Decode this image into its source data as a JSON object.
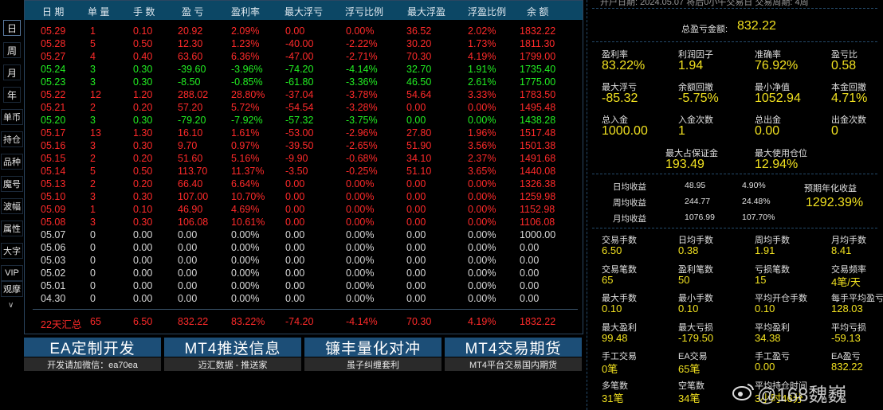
{
  "sidebar": {
    "items": [
      {
        "label": "日"
      },
      {
        "label": "周"
      },
      {
        "label": "月"
      },
      {
        "label": "年"
      },
      {
        "label": "单币"
      },
      {
        "label": "持仓"
      },
      {
        "label": "品种"
      },
      {
        "label": "魔号"
      },
      {
        "label": "波幅"
      },
      {
        "label": "属性"
      },
      {
        "label": "大字"
      },
      {
        "label": "VIP"
      },
      {
        "label": "观摩"
      }
    ]
  },
  "table": {
    "headers": [
      "日 期",
      "单 量",
      "手 数",
      "盈 亏",
      "盈利率",
      "最大浮亏",
      "浮亏比例",
      "最大浮盈",
      "浮盈比例",
      "余 额"
    ],
    "rows": [
      {
        "color": "red",
        "cells": [
          "05.29",
          "1",
          "0.10",
          "20.92",
          "2.09%",
          "0.00",
          "0.00%",
          "36.52",
          "2.02%",
          "1832.22"
        ]
      },
      {
        "color": "red",
        "cells": [
          "05.28",
          "5",
          "0.50",
          "12.30",
          "1.23%",
          "-40.00",
          "-2.22%",
          "30.20",
          "1.73%",
          "1811.30"
        ]
      },
      {
        "color": "red",
        "cells": [
          "05.27",
          "4",
          "0.40",
          "63.60",
          "6.36%",
          "-47.00",
          "-2.71%",
          "70.30",
          "4.19%",
          "1799.00"
        ]
      },
      {
        "color": "green",
        "cells": [
          "05.24",
          "3",
          "0.30",
          "-39.60",
          "-3.96%",
          "-74.20",
          "-4.14%",
          "32.70",
          "1.91%",
          "1735.40"
        ]
      },
      {
        "color": "green",
        "cells": [
          "05.23",
          "3",
          "0.30",
          "-8.50",
          "-0.85%",
          "-61.80",
          "-3.36%",
          "46.50",
          "2.61%",
          "1775.00"
        ]
      },
      {
        "color": "red",
        "cells": [
          "05.22",
          "12",
          "1.20",
          "288.02",
          "28.80%",
          "-37.04",
          "-3.78%",
          "54.64",
          "3.33%",
          "1783.50"
        ]
      },
      {
        "color": "red",
        "cells": [
          "05.21",
          "2",
          "0.20",
          "57.20",
          "5.72%",
          "-54.54",
          "-3.28%",
          "0.00",
          "0.00%",
          "1495.48"
        ]
      },
      {
        "color": "green",
        "cells": [
          "05.20",
          "3",
          "0.30",
          "-79.20",
          "-7.92%",
          "-57.32",
          "-3.75%",
          "0.00",
          "0.00%",
          "1438.28"
        ]
      },
      {
        "color": "red",
        "cells": [
          "05.17",
          "13",
          "1.30",
          "16.10",
          "1.61%",
          "-53.00",
          "-2.96%",
          "27.80",
          "1.96%",
          "1517.48"
        ]
      },
      {
        "color": "red",
        "cells": [
          "05.16",
          "3",
          "0.30",
          "9.70",
          "0.97%",
          "-39.50",
          "-2.65%",
          "51.90",
          "3.56%",
          "1501.38"
        ]
      },
      {
        "color": "red",
        "cells": [
          "05.15",
          "2",
          "0.20",
          "51.60",
          "5.16%",
          "-9.90",
          "-0.68%",
          "34.10",
          "2.37%",
          "1491.68"
        ]
      },
      {
        "color": "red",
        "cells": [
          "05.14",
          "5",
          "0.50",
          "113.70",
          "11.37%",
          "-3.50",
          "-0.25%",
          "51.10",
          "3.65%",
          "1440.08"
        ]
      },
      {
        "color": "red",
        "cells": [
          "05.13",
          "2",
          "0.20",
          "66.40",
          "6.64%",
          "0.00",
          "0.00%",
          "0.00",
          "0.00%",
          "1326.38"
        ]
      },
      {
        "color": "red",
        "cells": [
          "05.10",
          "3",
          "0.30",
          "107.00",
          "10.70%",
          "0.00",
          "0.00%",
          "0.00",
          "0.00%",
          "1259.98"
        ]
      },
      {
        "color": "red",
        "cells": [
          "05.09",
          "1",
          "0.10",
          "46.90",
          "4.69%",
          "0.00",
          "0.00%",
          "0.00",
          "0.00%",
          "1152.98"
        ]
      },
      {
        "color": "red",
        "cells": [
          "05.08",
          "3",
          "0.30",
          "106.08",
          "10.61%",
          "0.00",
          "0.00%",
          "0.00",
          "0.00%",
          "1106.08"
        ]
      },
      {
        "color": "white",
        "cells": [
          "05.07",
          "0",
          "0.00",
          "0.00",
          "0.00%",
          "0.00",
          "0.00%",
          "0.00",
          "0.00%",
          "1000.00"
        ]
      },
      {
        "color": "white",
        "cells": [
          "05.06",
          "0",
          "0.00",
          "0.00",
          "0.00%",
          "0.00",
          "0.00%",
          "0.00",
          "0.00%",
          "0.00"
        ]
      },
      {
        "color": "white",
        "cells": [
          "05.03",
          "0",
          "0.00",
          "0.00",
          "0.00%",
          "0.00",
          "0.00%",
          "0.00",
          "0.00%",
          "0.00"
        ]
      },
      {
        "color": "white",
        "cells": [
          "05.02",
          "0",
          "0.00",
          "0.00",
          "0.00%",
          "0.00",
          "0.00%",
          "0.00",
          "0.00%",
          "0.00"
        ]
      },
      {
        "color": "white",
        "cells": [
          "05.01",
          "0",
          "0.00",
          "0.00",
          "0.00%",
          "0.00",
          "0.00%",
          "0.00",
          "0.00%",
          "0.00"
        ]
      },
      {
        "color": "white",
        "cells": [
          "04.30",
          "0",
          "0.00",
          "0.00",
          "0.00%",
          "0.00",
          "0.00%",
          "0.00",
          "0.00%",
          "0.00"
        ]
      }
    ],
    "summary": [
      "22天汇总",
      "65",
      "6.50",
      "832.22",
      "83.22%",
      "-74.20",
      "-4.14%",
      "70.30",
      "4.19%",
      "1832.22"
    ]
  },
  "buttons": [
    {
      "title": "EA定制开发",
      "sub": "开发请加微信：ea70ea"
    },
    {
      "title": "MT4推送信息",
      "sub": "迈汇数据 - 推送家"
    },
    {
      "title": "镰丰量化对冲",
      "sub": "虽子纠缠套利"
    },
    {
      "title": "MT4交易期货",
      "sub": "MT4平台交易国内期货"
    }
  ],
  "panel": {
    "top_strip": "开户日期: 2024.05.07          将后0小午交易日          交易周期: 4周",
    "total_label": "总盈亏金额:",
    "total_value": "832.22",
    "grid1": [
      {
        "label": "盈利率",
        "value": "83.22%"
      },
      {
        "label": "利润因子",
        "value": "1.94"
      },
      {
        "label": "准确率",
        "value": "76.92%"
      },
      {
        "label": "盈亏比",
        "value": "0.58"
      },
      {
        "label": "最大浮亏",
        "value": "-85.32"
      },
      {
        "label": "余额回撤",
        "value": "-5.75%"
      },
      {
        "label": "最小净值",
        "value": "1052.94"
      },
      {
        "label": "本金回撤",
        "value": "4.71%"
      },
      {
        "label": "总入金",
        "value": "1000.00"
      },
      {
        "label": "入金次数",
        "value": "1"
      },
      {
        "label": "总出金",
        "value": "0.00"
      },
      {
        "label": "出金次数",
        "value": "0"
      }
    ],
    "margin": [
      {
        "label": "最大占保证金",
        "value": "193.49"
      },
      {
        "label": "最大使用仓位",
        "value": "12.94%"
      }
    ],
    "returns": [
      {
        "label": "日均收益",
        "amount": "48.95",
        "pct": "4.90%"
      },
      {
        "label": "周均收益",
        "amount": "244.77",
        "pct": "24.48%"
      },
      {
        "label": "月均收益",
        "amount": "1076.99",
        "pct": "107.70%"
      }
    ],
    "annual_label": "预期年化收益",
    "annual_value": "1292.39%",
    "grid2": [
      {
        "label": "交易手数",
        "value": "6.50"
      },
      {
        "label": "日均手数",
        "value": "0.38"
      },
      {
        "label": "周均手数",
        "value": "1.91"
      },
      {
        "label": "月均手数",
        "value": "8.41"
      },
      {
        "label": "交易笔数",
        "value": "65"
      },
      {
        "label": "盈利笔数",
        "value": "50"
      },
      {
        "label": "亏损笔数",
        "value": "15"
      },
      {
        "label": "交易频率",
        "value": "4笔/天"
      },
      {
        "label": "最大手数",
        "value": "0.10"
      },
      {
        "label": "最小手数",
        "value": "0.10"
      },
      {
        "label": "平均开仓手数",
        "value": "0.10"
      },
      {
        "label": "每手平均盈亏",
        "value": "128.03"
      },
      {
        "label": "最大盈利",
        "value": "99.48"
      },
      {
        "label": "最大亏损",
        "value": "-179.50"
      },
      {
        "label": "平均盈利",
        "value": "34.38"
      },
      {
        "label": "平均亏损",
        "value": "-59.13"
      },
      {
        "label": "手工交易",
        "value": "0笔"
      },
      {
        "label": "EA交易",
        "value": "65笔"
      },
      {
        "label": "手工盈亏",
        "value": "0.00"
      },
      {
        "label": "EA盈亏",
        "value": "832.22"
      },
      {
        "label": "多笔数",
        "value": "31笔"
      },
      {
        "label": "空笔数",
        "value": "34笔"
      },
      {
        "label": "平均持仓时间",
        "value": "3小时46分"
      },
      {
        "label": "",
        "value": ""
      }
    ]
  },
  "watermark": "@168魏巍"
}
